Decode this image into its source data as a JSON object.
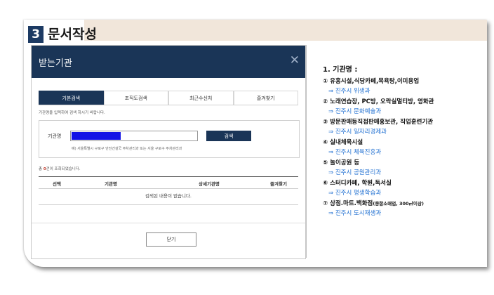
{
  "step": {
    "number": "3",
    "title": "문서작성"
  },
  "dialog": {
    "title": "받는기관",
    "close_glyph": "✕",
    "tabs": [
      "기본검색",
      "조직도검색",
      "최근수신처",
      "즐겨찾기"
    ],
    "hint": "기관명을 입력하여 검색 하시기 바랍니다.",
    "search_label": "기관명",
    "search_button": "검색",
    "example": "예) 서울특별시 구로구 안전건설국 주차관리과 또는 서울 구로구 주차관리과",
    "count_prefix": "총",
    "count_value": "0",
    "count_suffix": "건이 조회되었습니다.",
    "columns": [
      "선택",
      "기관명",
      "상세기관명",
      "즐겨찾기"
    ],
    "empty_message": "검색된 내용이 없습니다.",
    "close_button": "닫기"
  },
  "panel": {
    "title": "1.  기관명  :",
    "items": [
      {
        "label": "① 유흥시설,식당카페,목욕탕,이미용업",
        "dept": "⇒ 진주시 위생과"
      },
      {
        "label": "② 노래연습장, PC방, 오락실멀티방, 영화관",
        "dept": "⇒ 진주시 문화예술과"
      },
      {
        "label": "③ 방문판매등직접판매홍보관, 직업훈련기관",
        "dept": "⇒ 진주시 일자리경제과"
      },
      {
        "label": "④ 실내체육시설",
        "dept": "⇒ 진주시 체육진흥과"
      },
      {
        "label": "⑤ 놀이공원 등",
        "dept": "⇒ 진주시 공원관리과"
      },
      {
        "label": "⑥ 스터디카페, 학원,독서실",
        "dept": "⇒ 진주시 평생학습과"
      },
      {
        "label": "⑦ 상점.마트.백화점",
        "label_small": "(종합소매업, 300㎡이상)",
        "dept": "⇒ 진주시 도시재생과"
      }
    ]
  },
  "colors": {
    "navy": "#1a3557",
    "link_blue": "#1f6fd1",
    "beige": "#f1e6da",
    "input_fill": "#1414e6"
  }
}
